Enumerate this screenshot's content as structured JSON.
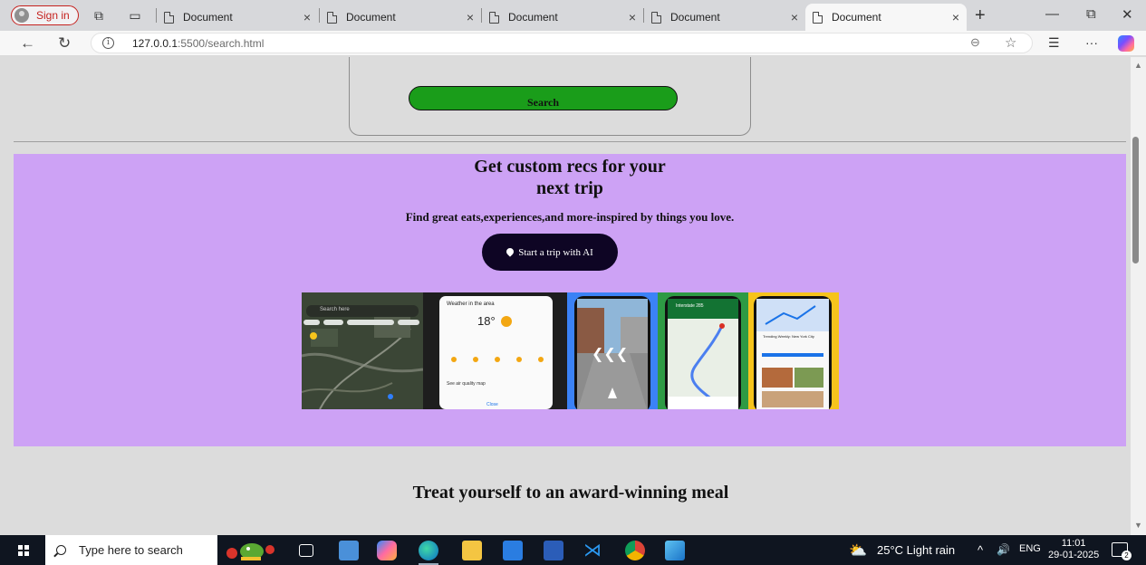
{
  "browser": {
    "signin_label": "Sign in",
    "tabs": [
      {
        "title": "Document",
        "active": false
      },
      {
        "title": "Document",
        "active": false
      },
      {
        "title": "Document",
        "active": false
      },
      {
        "title": "Document",
        "active": false
      },
      {
        "title": "Document",
        "active": true
      }
    ],
    "close_glyph": "×",
    "new_tab_glyph": "+",
    "address": {
      "host": "127.0.0.1",
      "path": ":5500/search.html"
    }
  },
  "page": {
    "search_button": "Search",
    "promo": {
      "heading_line1": "Get custom recs for your",
      "heading_line2": "next trip",
      "subtitle": "Find great eats,experiences,and more-inspired by things you love.",
      "cta": "Start a trip with AI",
      "background": "#cda2f5"
    },
    "gallery": {
      "map_search_placeholder": "Search here",
      "weather_title": "Weather in the area",
      "weather_temp": "18°",
      "weather_aq": "See air quality map",
      "weather_close": "Close",
      "route_title": "Interstate 285",
      "trend_title": "Trending Weekly: New York City"
    },
    "section_title": "Treat yourself to an award-winning meal"
  },
  "taskbar": {
    "search_placeholder": "Type here to search",
    "weather": "25°C  Light rain",
    "lang": "ENG",
    "time": "11:01",
    "date": "29-01-2025",
    "notification_count": "2"
  },
  "colors": {
    "search_button": "#1a9d1a",
    "cta_button": "#0e0524",
    "signin_accent": "#c5221f"
  }
}
